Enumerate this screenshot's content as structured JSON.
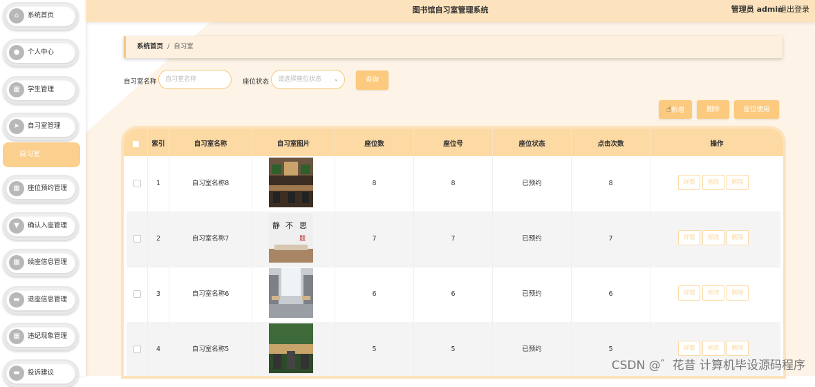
{
  "sidebar": {
    "items": [
      {
        "label": "系统首页",
        "icon": "home-icon"
      },
      {
        "label": "个人中心",
        "icon": "user-icon"
      },
      {
        "label": "学生管理",
        "icon": "grid-icon"
      },
      {
        "label": "自习室管理",
        "icon": "send-icon"
      },
      {
        "label": "座位预约管理",
        "icon": "grid-icon"
      },
      {
        "label": "确认入座管理",
        "icon": "pin-icon"
      },
      {
        "label": "续座信息管理",
        "icon": "table-icon"
      },
      {
        "label": "退座信息管理",
        "icon": "chat-icon"
      },
      {
        "label": "违纪现象管理",
        "icon": "grid-icon"
      },
      {
        "label": "投诉建议",
        "icon": "chat-icon"
      }
    ],
    "submenu_active": "自习室"
  },
  "header": {
    "title": "图书馆自习室管理系统",
    "user": "管理员 admin",
    "logout": "退出登录"
  },
  "breadcrumb": {
    "home": "系统首页",
    "sep": "/",
    "current": "自习室"
  },
  "search": {
    "name_label": "自习室名称",
    "name_placeholder": "自习室名称",
    "status_label": "座位状态",
    "status_placeholder": "请选择座位状态",
    "query_button": "查询"
  },
  "actions": {
    "add": "新增",
    "delete": "删除",
    "seat_use": "座位使用"
  },
  "table": {
    "headers": [
      "索引",
      "自习室名称",
      "自习室图片",
      "座位数",
      "座位号",
      "座位状态",
      "点击次数",
      "操作"
    ],
    "rows": [
      {
        "index": "1",
        "name": "自习室名称8",
        "seats": "8",
        "seat_no": "8",
        "status": "已预约",
        "clicks": "8"
      },
      {
        "index": "2",
        "name": "自习室名称7",
        "seats": "7",
        "seat_no": "7",
        "status": "已预约",
        "clicks": "7"
      },
      {
        "index": "3",
        "name": "自习室名称6",
        "seats": "6",
        "seat_no": "6",
        "status": "已预约",
        "clicks": "6"
      },
      {
        "index": "4",
        "name": "自习室名称5",
        "seats": "5",
        "seat_no": "5",
        "status": "已预约",
        "clicks": "5"
      }
    ],
    "row_ops": {
      "detail": "详情",
      "edit": "修改",
      "delete": "删除"
    }
  },
  "watermark": "CSDN @゛花昔  计算机毕设源码程序",
  "colors": {
    "accent": "#fcca7e",
    "header_bg": "#fde3bd",
    "table_head": "#fdd9a3"
  }
}
